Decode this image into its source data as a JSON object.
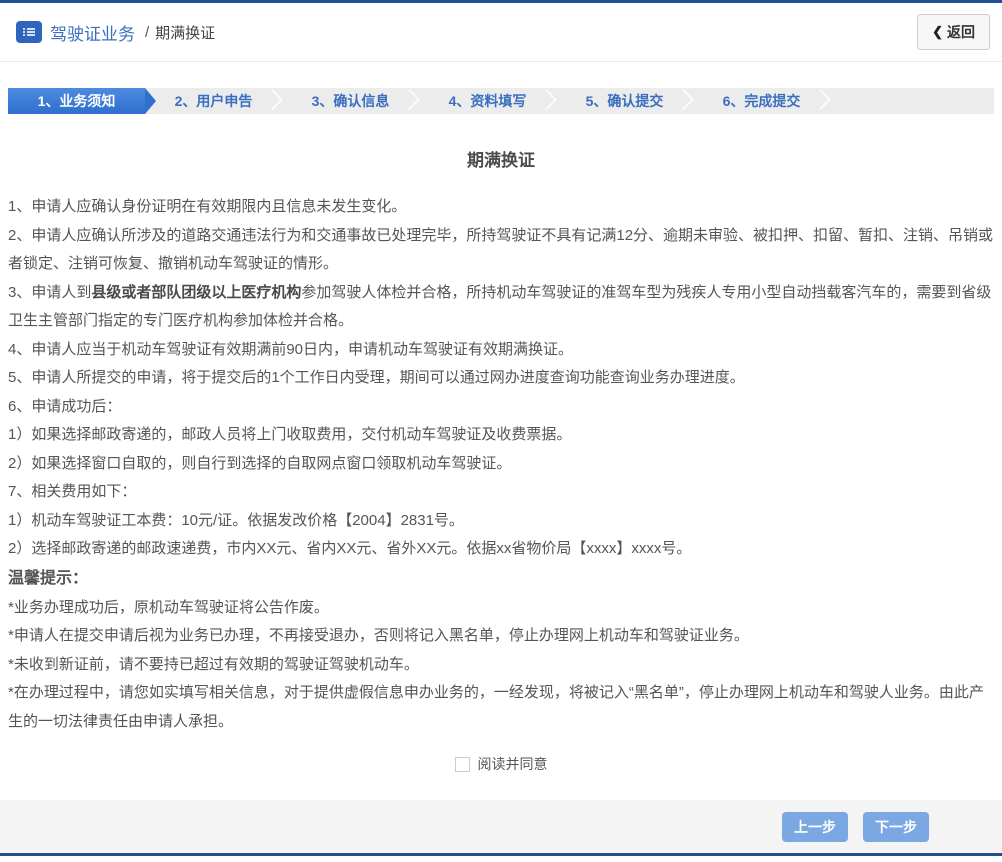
{
  "header": {
    "breadcrumb_section": "驾驶证业务",
    "breadcrumb_separator": "/",
    "breadcrumb_current": "期满换证",
    "back_label": "返回",
    "back_chevron": "❮"
  },
  "steps": [
    {
      "label": "1、业务须知",
      "active": true
    },
    {
      "label": "2、用户申告",
      "active": false
    },
    {
      "label": "3、确认信息",
      "active": false
    },
    {
      "label": "4、资料填写",
      "active": false
    },
    {
      "label": "5、确认提交",
      "active": false
    },
    {
      "label": "6、完成提交",
      "active": false
    }
  ],
  "content": {
    "title": "期满换证",
    "notices": [
      {
        "segments": [
          {
            "text": "1、申请人应确认身份证明在有效期限内且信息未发生变化。"
          }
        ]
      },
      {
        "segments": [
          {
            "text": "2、申请人应确认所涉及的道路交通违法行为和交通事故已处理完毕，所持驾驶证不具有记满12分、逾期未审验、被扣押、扣留、暂扣、注销、吊销或者锁定、注销可恢复、撤销机动车驾驶证的情形。"
          }
        ]
      },
      {
        "segments": [
          {
            "text": "3、申请人到"
          },
          {
            "text": "县级或者部队团级以上医疗机构",
            "bold": true
          },
          {
            "text": "参加驾驶人体检并合格，所持机动车驾驶证的准驾车型为残疾人专用小型自动挡载客汽车的，需要到省级卫生主管部门指定的专门医疗机构参加体检并合格。"
          }
        ]
      },
      {
        "segments": [
          {
            "text": "4、申请人应当于机动车驾驶证有效期满前90日内，申请机动车驾驶证有效期满换证。"
          }
        ]
      },
      {
        "segments": [
          {
            "text": "5、申请人所提交的申请，将于提交后的1个工作日内受理，期间可以通过网办进度查询功能查询业务办理进度。"
          }
        ]
      },
      {
        "segments": [
          {
            "text": "6、申请成功后："
          }
        ]
      },
      {
        "segments": [
          {
            "text": "1）如果选择邮政寄递的，邮政人员将上门收取费用，交付机动车驾驶证及收费票据。"
          }
        ]
      },
      {
        "segments": [
          {
            "text": "2）如果选择窗口自取的，则自行到选择的自取网点窗口领取机动车驾驶证。"
          }
        ]
      },
      {
        "segments": [
          {
            "text": "7、相关费用如下："
          }
        ]
      },
      {
        "segments": [
          {
            "text": "1）机动车驾驶证工本费：10元/证。依据发改价格【2004】2831号。"
          }
        ]
      },
      {
        "segments": [
          {
            "text": "2）选择邮政寄递的邮政速递费，市内XX元、省内XX元、省外XX元。依据xx省物价局【xxxx】xxxx号。"
          }
        ]
      },
      {
        "tip_head": true,
        "segments": [
          {
            "text": "温馨提示："
          }
        ]
      },
      {
        "segments": [
          {
            "text": "*业务办理成功后，原机动车驾驶证将公告作废。"
          }
        ]
      },
      {
        "segments": [
          {
            "text": "*申请人在提交申请后视为业务已办理，不再接受退办，否则将记入黑名单，停止办理网上机动车和驾驶证业务。"
          }
        ]
      },
      {
        "segments": [
          {
            "text": "*未收到新证前，请不要持已超过有效期的驾驶证驾驶机动车。"
          }
        ]
      },
      {
        "segments": [
          {
            "text": "*在办理过程中，请您如实填写相关信息，对于提供虚假信息申办业务的，一经发现，将被记入“黑名单”，停止办理网上机动车和驾驶人业务。由此产生的一切法律责任由申请人承担。"
          }
        ]
      }
    ],
    "agree": {
      "label": "阅读并同意",
      "checked": false
    }
  },
  "footer": {
    "prev_label": "上一步",
    "next_label": "下一步"
  },
  "colors": {
    "top_border": "#1d5191",
    "accent_blue": "#3a6fc0",
    "active_step": "#3b7ad7",
    "button_blue": "#7ba7e3",
    "footer_bg": "#f4f4f4"
  }
}
